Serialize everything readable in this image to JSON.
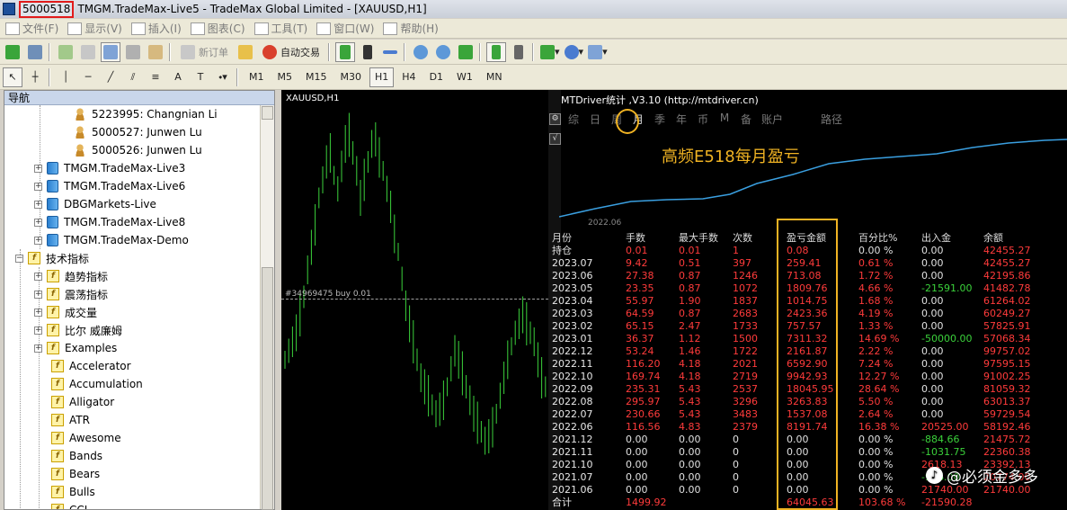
{
  "window": {
    "account_id": "5000518",
    "title": "TMGM.TradeMax-Live5 - TradeMax Global Limited - [XAUUSD,H1]"
  },
  "menu": [
    "文件(F)",
    "显示(V)",
    "插入(I)",
    "图表(C)",
    "工具(T)",
    "窗口(W)",
    "帮助(H)"
  ],
  "toolbar": {
    "new_order": "新订单",
    "auto_trade": "自动交易",
    "timeframes": [
      "M1",
      "M5",
      "M15",
      "M30",
      "H1",
      "H4",
      "D1",
      "W1",
      "MN"
    ],
    "active_timeframe": "H1"
  },
  "navigator": {
    "title": "导航",
    "accounts": [
      "5223995: Changnian Li",
      "5000527: Junwen Lu",
      "5000526: Junwen Lu"
    ],
    "servers": [
      "TMGM.TradeMax-Live3",
      "TMGM.TradeMax-Live6",
      "DBGMarkets-Live",
      "TMGM.TradeMax-Live8",
      "TMGM.TradeMax-Demo"
    ],
    "indicators_root": "技术指标",
    "indicator_groups": [
      "趋势指标",
      "震荡指标",
      "成交量",
      "比尔 威廉姆",
      "Examples"
    ],
    "indicators": [
      "Accelerator",
      "Accumulation",
      "Alligator",
      "ATR",
      "Awesome",
      "Bands",
      "Bears",
      "Bulls",
      "CCI"
    ]
  },
  "chart": {
    "symbol_label": "XAUUSD,H1",
    "order_label": "#34969475 buy 0.01",
    "up_color": "#3bd23b"
  },
  "stats": {
    "header": "MTDriver统计 ,V3.10 (http://mtdriver.cn)",
    "tabs": [
      "综",
      "日",
      "周",
      "月",
      "季",
      "年",
      "币",
      "M",
      "备",
      "账户"
    ],
    "active_tab": "月",
    "path_label": "路径",
    "overlay_title": "高频E518每月盈亏",
    "curve_date": "2022.06",
    "columns": [
      "月份",
      "手数",
      "最大手数",
      "次数",
      "盈亏金额",
      "百分比%",
      "出入金",
      "余额"
    ],
    "rows": [
      [
        "持仓",
        "0.01",
        "0.01",
        "1",
        "0.08",
        "0.00 %",
        "0.00",
        "42455.27"
      ],
      [
        "2023.07",
        "9.42",
        "0.51",
        "397",
        "259.41",
        "0.61 %",
        "0.00",
        "42455.27"
      ],
      [
        "2023.06",
        "27.38",
        "0.87",
        "1246",
        "713.08",
        "1.72 %",
        "0.00",
        "42195.86"
      ],
      [
        "2023.05",
        "23.35",
        "0.87",
        "1072",
        "1809.76",
        "4.66 %",
        "-21591.00",
        "41482.78"
      ],
      [
        "2023.04",
        "55.97",
        "1.90",
        "1837",
        "1014.75",
        "1.68 %",
        "0.00",
        "61264.02"
      ],
      [
        "2023.03",
        "64.59",
        "0.87",
        "2683",
        "2423.36",
        "4.19 %",
        "0.00",
        "60249.27"
      ],
      [
        "2023.02",
        "65.15",
        "2.47",
        "1733",
        "757.57",
        "1.33 %",
        "0.00",
        "57825.91"
      ],
      [
        "2023.01",
        "36.37",
        "1.12",
        "1500",
        "7311.32",
        "14.69 %",
        "-50000.00",
        "57068.34"
      ],
      [
        "2022.12",
        "53.24",
        "1.46",
        "1722",
        "2161.87",
        "2.22 %",
        "0.00",
        "99757.02"
      ],
      [
        "2022.11",
        "116.20",
        "4.18",
        "2021",
        "6592.90",
        "7.24 %",
        "0.00",
        "97595.15"
      ],
      [
        "2022.10",
        "169.74",
        "4.18",
        "2719",
        "9942.93",
        "12.27 %",
        "0.00",
        "91002.25"
      ],
      [
        "2022.09",
        "235.31",
        "5.43",
        "2537",
        "18045.95",
        "28.64 %",
        "0.00",
        "81059.32"
      ],
      [
        "2022.08",
        "295.97",
        "5.43",
        "3296",
        "3263.83",
        "5.50 %",
        "0.00",
        "63013.37"
      ],
      [
        "2022.07",
        "230.66",
        "5.43",
        "3483",
        "1537.08",
        "2.64 %",
        "0.00",
        "59729.54"
      ],
      [
        "2022.06",
        "116.56",
        "4.83",
        "2379",
        "8191.74",
        "16.38 %",
        "20525.00",
        "58192.46"
      ],
      [
        "2021.12",
        "0.00",
        "0.00",
        "0",
        "0.00",
        "0.00 %",
        "-884.66",
        "21475.72"
      ],
      [
        "2021.11",
        "0.00",
        "0.00",
        "0",
        "0.00",
        "0.00 %",
        "-1031.75",
        "22360.38"
      ],
      [
        "2021.10",
        "0.00",
        "0.00",
        "0",
        "0.00",
        "0.00 %",
        "2618.13",
        "23392.13"
      ],
      [
        "2021.07",
        "0.00",
        "0.00",
        "0",
        "0.00",
        "0.00 %",
        "-966.00",
        "20774.00"
      ],
      [
        "2021.06",
        "0.00",
        "0.00",
        "0",
        "0.00",
        "0.00 %",
        "21740.00",
        "21740.00"
      ]
    ],
    "total": [
      "合计",
      "1499.92",
      "",
      "",
      "64045.63",
      "103.68 %",
      "-21590.28",
      ""
    ],
    "accent_color": "#f0b323",
    "positive_color": "#ff3b3b",
    "negative_color": "#3bd23b"
  },
  "watermark": "@必须金多多"
}
